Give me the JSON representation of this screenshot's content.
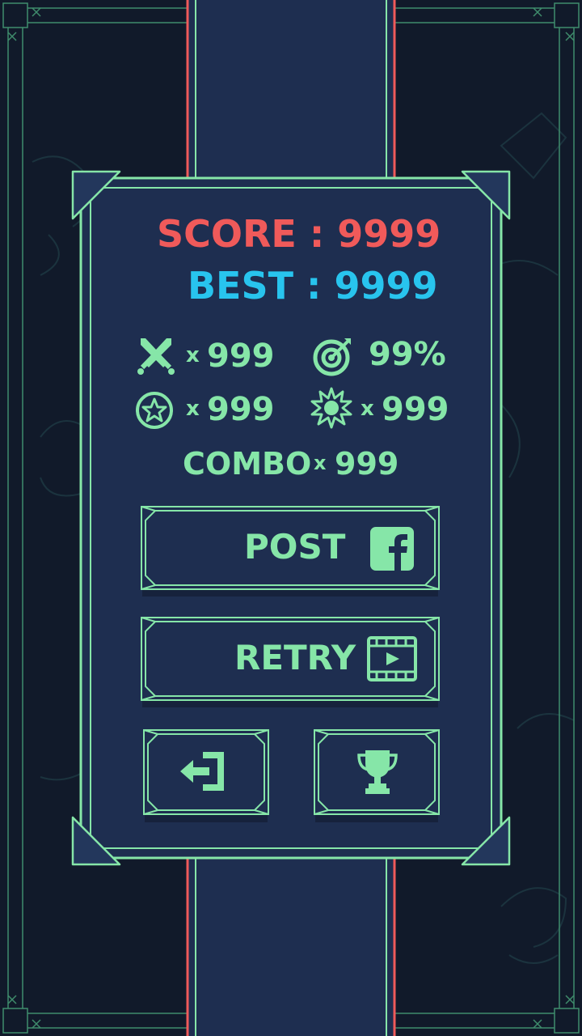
{
  "score": {
    "label": "SCORE",
    "separator": ":",
    "value": "9999"
  },
  "best": {
    "label": "BEST",
    "separator": ":",
    "value": "9999"
  },
  "stats": {
    "kills": {
      "icon": "crossed-swords-icon",
      "prefix": "x",
      "value": "999"
    },
    "accuracy": {
      "icon": "target-arrow-icon",
      "value": "99%"
    },
    "stars": {
      "icon": "star-badge-icon",
      "prefix": "x",
      "value": "999"
    },
    "explosions": {
      "icon": "explosion-icon",
      "prefix": "x",
      "value": "999"
    }
  },
  "combo": {
    "label": "COMBO",
    "prefix": "x",
    "value": "999"
  },
  "buttons": {
    "post": {
      "label": "POST",
      "icon": "facebook-icon"
    },
    "retry": {
      "label": "RETRY",
      "icon": "video-play-icon"
    },
    "exit": {
      "icon": "exit-icon"
    },
    "leaderboard": {
      "icon": "trophy-icon"
    }
  },
  "colors": {
    "score": "#f05a5a",
    "best": "#28c4ee",
    "accent": "#86e6a8",
    "panel": "#1e2e50",
    "background": "#111a2a"
  }
}
